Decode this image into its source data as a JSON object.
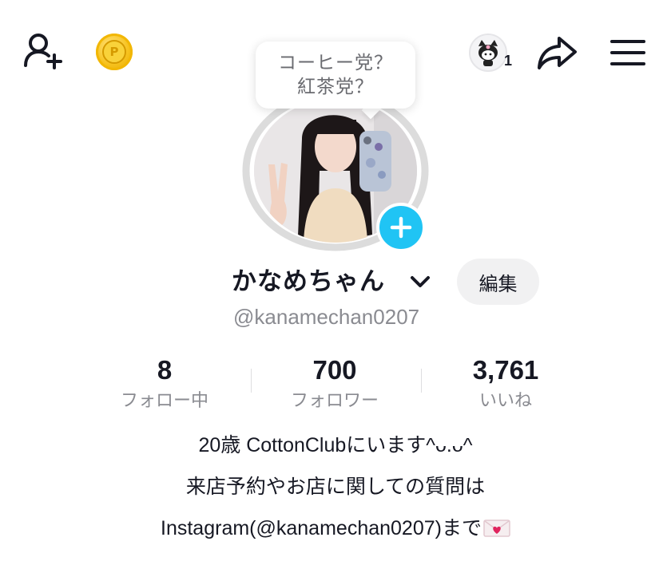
{
  "top_bar": {
    "coin_letter": "P",
    "visitor_count": "1"
  },
  "bubble": {
    "line1": "コーヒー党？",
    "line2": "紅茶党？"
  },
  "profile": {
    "display_name": "かなめちゃん",
    "edit_label": "編集",
    "username": "@kanamechan0207"
  },
  "stats": [
    {
      "value": "8",
      "label": "フォロー中"
    },
    {
      "value": "700",
      "label": "フォロワー"
    },
    {
      "value": "3,761",
      "label": "いいね"
    }
  ],
  "bio": {
    "line1": "20歳 CottonClubにいます^ᴗ.ᴗ^",
    "line2": "来店予約やお店に関しての質問は",
    "line3": "Instagram(@kanamechan0207)まで"
  },
  "colors": {
    "accent": "#20c4f4",
    "text": "#161823",
    "muted": "#8a8b91",
    "coin": "#f7c21e"
  },
  "icons": [
    "add-user-icon",
    "coin-icon",
    "share-icon",
    "menu-icon",
    "chevron-down-icon",
    "plus-icon",
    "mail-heart-icon"
  ]
}
